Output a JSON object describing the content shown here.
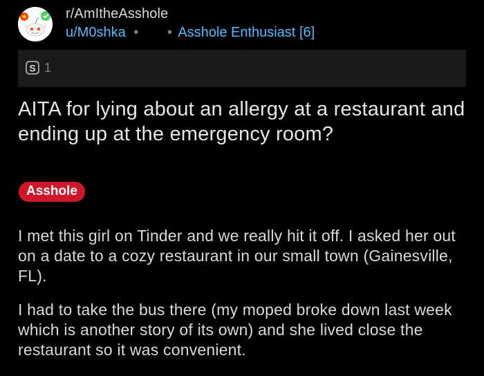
{
  "post": {
    "subreddit": "r/AmItheAsshole",
    "username": "u/M0shka",
    "separator": "•",
    "user_flair": "Asshole Enthusiast [6]",
    "award_count": "1",
    "title": "AITA for lying about an allergy at a restaurant and ending up at the emergency room?",
    "flair": "Asshole",
    "body_paragraphs": [
      "I met this girl on Tinder and we really hit it off. I asked her out on a date to a cozy restaurant in our small town (Gainesville, FL).",
      "I had to take the bus there (my moped broke down last week which is another story of its own) and she lived close the restaurant so it was convenient."
    ]
  },
  "colors": {
    "background": "#000000",
    "link_blue": "#4fbcff",
    "flair_red": "#d0172a",
    "awards_bar": "#1a1a1b"
  },
  "icons": {
    "avatar": "snoo-avatar-icon",
    "award": "silver-award-icon"
  }
}
